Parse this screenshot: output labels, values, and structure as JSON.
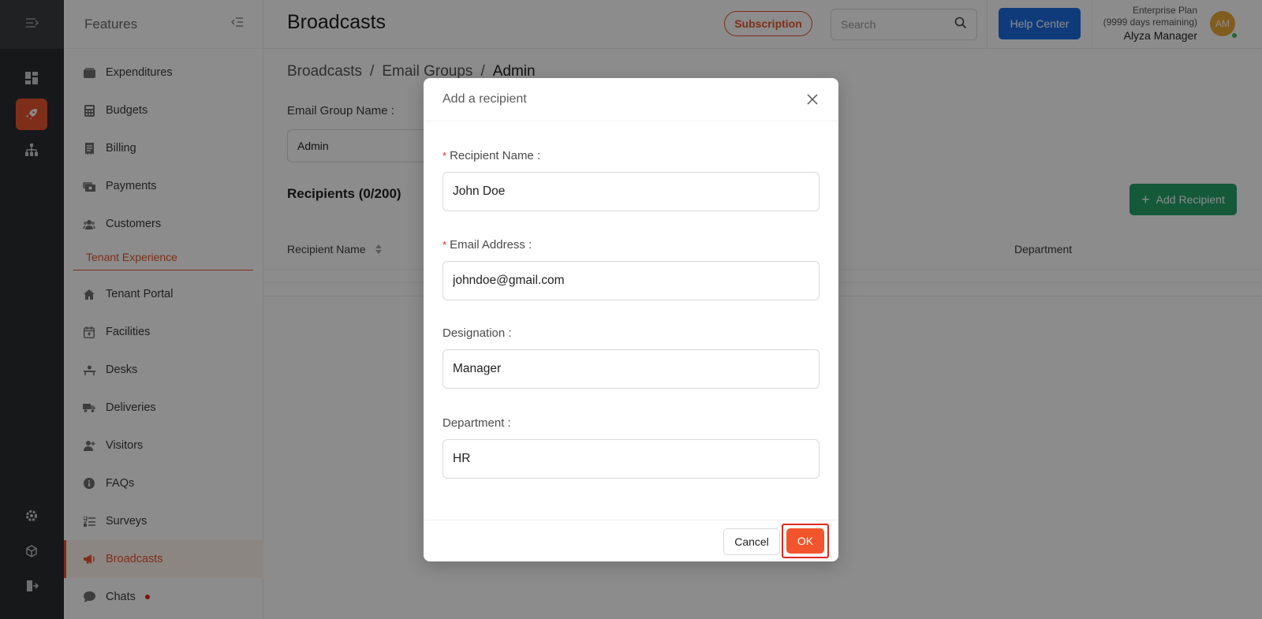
{
  "rail": {
    "icons": [
      "expand-menu-icon",
      "dashboard-icon",
      "rocket-icon",
      "hierarchy-icon",
      "gear-icon",
      "cube-icon",
      "logout-icon"
    ]
  },
  "sidebar": {
    "title": "Features",
    "items": [
      {
        "label": "Expenditures",
        "icon": "wallet-icon"
      },
      {
        "label": "Budgets",
        "icon": "calculator-icon"
      },
      {
        "label": "Billing",
        "icon": "receipt-icon"
      },
      {
        "label": "Payments",
        "icon": "money-icon"
      },
      {
        "label": "Customers",
        "icon": "users-icon"
      },
      {
        "label": "Tenant Portal",
        "icon": "home-icon"
      },
      {
        "label": "Facilities",
        "icon": "calendar-icon"
      },
      {
        "label": "Desks",
        "icon": "desk-icon"
      },
      {
        "label": "Deliveries",
        "icon": "truck-icon"
      },
      {
        "label": "Visitors",
        "icon": "visitor-icon"
      },
      {
        "label": "FAQs",
        "icon": "info-icon"
      },
      {
        "label": "Surveys",
        "icon": "list-icon"
      },
      {
        "label": "Broadcasts",
        "icon": "megaphone-icon"
      },
      {
        "label": "Chats",
        "icon": "chat-icon"
      }
    ],
    "section_label": "Tenant Experience",
    "active": "Broadcasts"
  },
  "header": {
    "title": "Broadcasts",
    "subscription_label": "Subscription",
    "search_placeholder": "Search",
    "help_label": "Help Center",
    "plan_name": "Enterprise Plan",
    "plan_remaining": "(9999 days remaining)",
    "user_name": "Alyza Manager",
    "avatar_initials": "AM"
  },
  "main": {
    "breadcrumb": [
      "Broadcasts",
      "Email Groups",
      "Admin"
    ],
    "group_name_label": "Email Group Name :",
    "group_name_value": "Admin",
    "recipients_title": "Recipients (0/200)",
    "add_recipient_label": "Add Recipient",
    "columns": {
      "name": "Recipient Name",
      "department": "Department"
    }
  },
  "modal": {
    "title": "Add a recipient",
    "fields": [
      {
        "label": "Recipient Name :",
        "value": "John Doe",
        "required": true
      },
      {
        "label": "Email Address :",
        "value": "johndoe@gmail.com",
        "required": true
      },
      {
        "label": "Designation :",
        "value": "Manager",
        "required": false
      },
      {
        "label": "Department :",
        "value": "HR",
        "required": false
      }
    ],
    "cancel_label": "Cancel",
    "ok_label": "OK"
  },
  "colors": {
    "accent": "#e8542e",
    "help_blue": "#1d6ce0",
    "add_green": "#23a36b"
  }
}
